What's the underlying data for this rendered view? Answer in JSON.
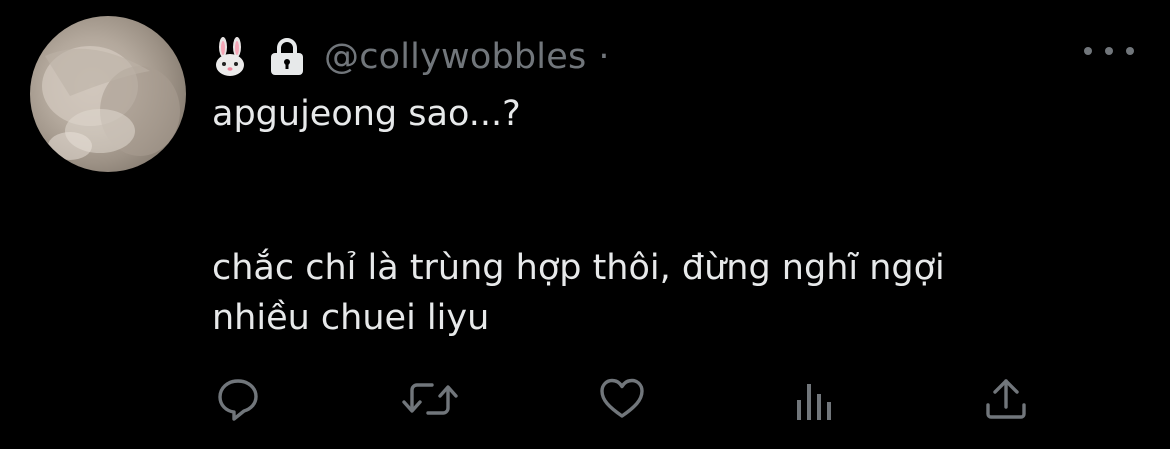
{
  "user": {
    "handle": "@collywobbles",
    "separator": "·",
    "emoji_icon": "bunny-emoji-icon",
    "lock_icon": "lock-icon"
  },
  "tweet": {
    "line_1": "apgujeong sao...?",
    "line_2": "chắc chỉ là trùng hợp thôi, đừng nghĩ ngợi\nnhiều chuei liyu"
  },
  "actions": {
    "icons": [
      "reply-icon",
      "retweet-icon",
      "like-icon",
      "analytics-icon",
      "share-icon"
    ]
  },
  "colors": {
    "background": "#000000",
    "text": "#e7e9ea",
    "secondary": "#71767b"
  }
}
